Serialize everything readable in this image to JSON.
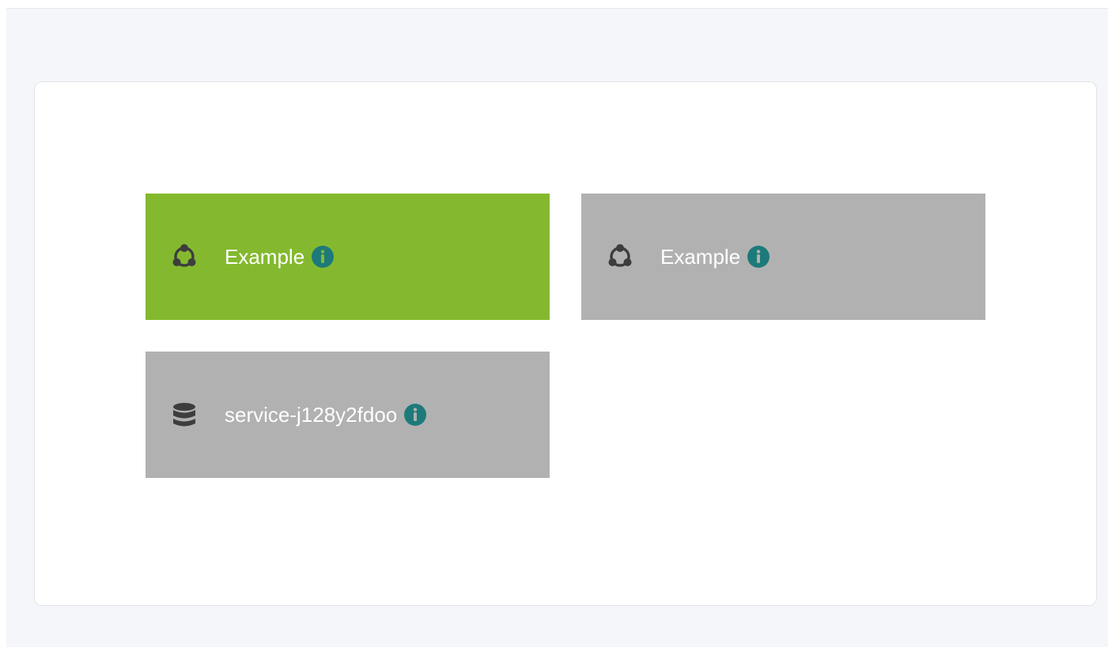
{
  "colors": {
    "active_tile": "#84b92f",
    "inactive_tile": "#b1b1b1",
    "info_icon": "#1e7a7a",
    "tile_icon": "#3d3d3d",
    "page_background": "#f5f6f9",
    "panel_background": "#ffffff"
  },
  "tiles": [
    {
      "label": "Example",
      "icon": "network-icon",
      "state": "active"
    },
    {
      "label": "Example",
      "icon": "network-icon",
      "state": "inactive"
    },
    {
      "label": "service-j128y2fdoo",
      "icon": "database-icon",
      "state": "inactive"
    }
  ]
}
